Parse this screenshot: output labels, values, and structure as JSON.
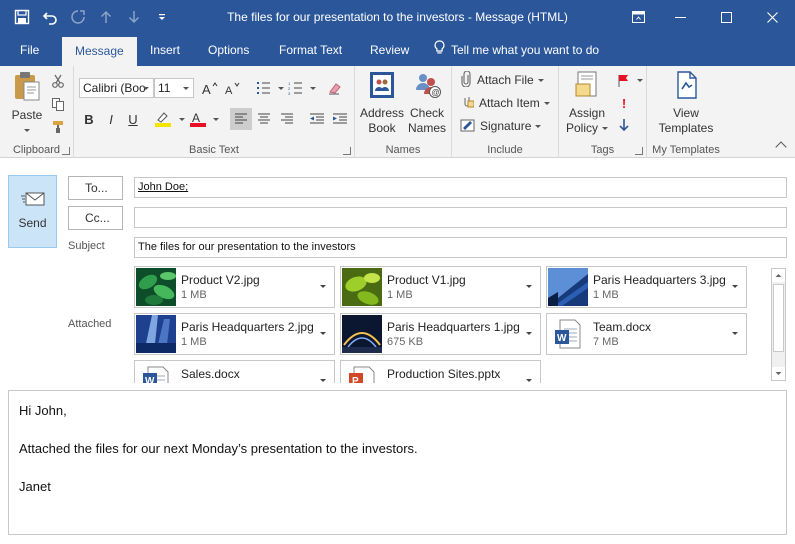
{
  "window": {
    "title": "The files for our presentation to the investors  -  Message (HTML)",
    "title_bar_color": "#2b579a"
  },
  "quick_access": [
    "save-icon",
    "undo-icon",
    "redo-icon",
    "previous-item-icon",
    "next-item-icon",
    "customize-qat-icon"
  ],
  "tabs": [
    {
      "label": "File"
    },
    {
      "label": "Message"
    },
    {
      "label": "Insert"
    },
    {
      "label": "Options"
    },
    {
      "label": "Format Text"
    },
    {
      "label": "Review"
    }
  ],
  "tell_me": "Tell me what you want to do",
  "active_tab": "Message",
  "ribbon": {
    "clipboard": {
      "label": "Clipboard",
      "paste": "Paste"
    },
    "basic_text": {
      "label": "Basic Text",
      "font": "Calibri (Boo",
      "size": "11"
    },
    "names": {
      "label": "Names",
      "address_book": [
        "Address",
        "Book"
      ],
      "check_names": [
        "Check",
        "Names"
      ]
    },
    "include": {
      "label": "Include",
      "attach_file": "Attach File",
      "attach_item": "Attach Item",
      "signature": "Signature"
    },
    "tags": {
      "label": "Tags",
      "assign_policy": [
        "Assign",
        "Policy"
      ]
    },
    "my_templates": {
      "label": "My Templates",
      "view_templates": [
        "View",
        "Templates"
      ]
    }
  },
  "compose": {
    "send": "Send",
    "to_button": "To...",
    "cc_button": "Cc...",
    "to_value": "John Doe;",
    "cc_value": "",
    "subject_label": "Subject",
    "subject_value": "The files for our presentation to the investors",
    "attached_label": "Attached"
  },
  "attachments": [
    {
      "name": "Product V2.jpg",
      "size": "1 MB",
      "icon": "green-leaves-thumbnail"
    },
    {
      "name": "Product V1.jpg",
      "size": "1 MB",
      "icon": "lime-leaves-thumbnail"
    },
    {
      "name": "Paris Headquarters 3.jpg",
      "size": "1 MB",
      "icon": "blue-building-thumbnail"
    },
    {
      "name": "Paris Headquarters 2.jpg",
      "size": "1 MB",
      "icon": "blue-tower-thumbnail"
    },
    {
      "name": "Paris Headquarters 1.jpg",
      "size": "675 KB",
      "icon": "night-arch-thumbnail"
    },
    {
      "name": "Team.docx",
      "size": "7 MB",
      "icon": "word-document-icon"
    },
    {
      "name": "Sales.docx",
      "size": "",
      "icon": "word-document-icon"
    },
    {
      "name": "Production Sites.pptx",
      "size": "",
      "icon": "powerpoint-document-icon"
    }
  ],
  "body": {
    "lines": [
      "Hi John,",
      "Attached the files for our next Monday’s presentation to the investors.",
      "Janet"
    ]
  }
}
